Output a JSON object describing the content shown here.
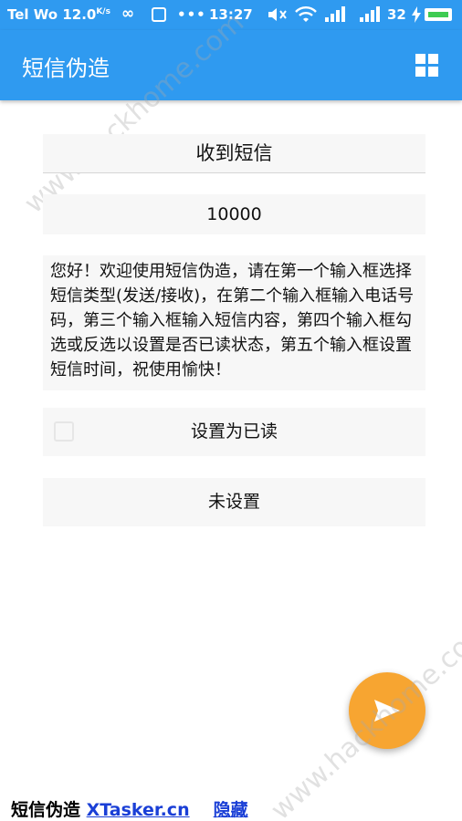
{
  "status_bar": {
    "carrier": "Tel Wo 12.0",
    "speed_unit": "K/s",
    "infinity": "∞",
    "dots": "•••",
    "time": "13:27",
    "mute": "🔇",
    "wifi": "📶",
    "signal1": "▂▄▆",
    "signal2": "▂▄▆",
    "battery_pct": "32",
    "bolt": "⚡",
    "battery_color": "#3ecb52"
  },
  "app_bar": {
    "title": "短信伪造",
    "color": "#2f9af0",
    "menu_icon": "grid-icon"
  },
  "form": {
    "sms_type": "收到短信",
    "phone_number": "10000",
    "message_content": "您好！欢迎使用短信伪造，请在第一个输入框选择短信类型(发送/接收)，在第二个输入框输入电话号码，第三个输入框输入短信内容，第四个输入框勾选或反选以设置是否已读状态，第五个输入框设置短信时间，祝使用愉快！",
    "read_label": "设置为已读",
    "read_checked": false,
    "time_label": "未设置"
  },
  "fab": {
    "icon": "send-icon",
    "color": "#f7a531"
  },
  "footer": {
    "prefix": "短信伪造 ",
    "link_site": "XTasker.cn",
    "link_hide": "隐藏"
  },
  "watermark": {
    "text": "www.hackhome.com"
  }
}
